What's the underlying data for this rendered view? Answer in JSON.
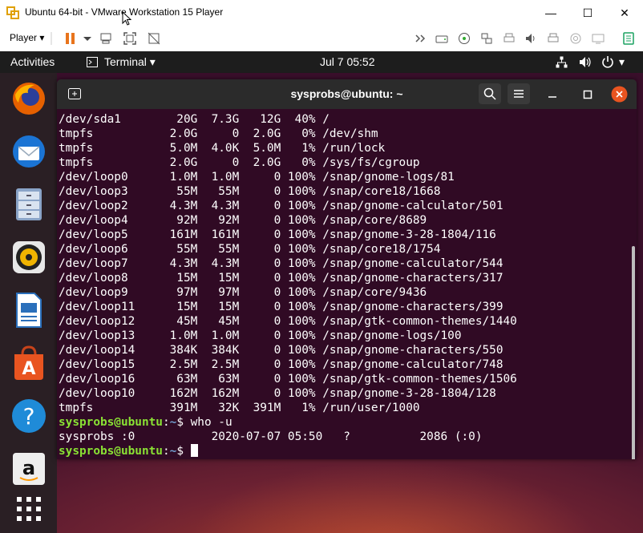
{
  "window": {
    "title": "Ubuntu 64-bit - VMware Workstation 15 Player",
    "minimize": "—",
    "maximize": "☐",
    "close": "✕"
  },
  "toolbar": {
    "player_label": "Player",
    "dropdown_arrow": "▾"
  },
  "gnome": {
    "activities": "Activities",
    "app_menu": "Terminal ▾",
    "clock": "Jul 7  05:52",
    "power_arrow": "▾"
  },
  "dock": {
    "apps": [
      "firefox-icon",
      "thunderbird-icon",
      "files-icon",
      "rhythmbox-icon",
      "writer-icon",
      "software-icon",
      "help-icon",
      "amazon-icon",
      "show-apps-icon"
    ]
  },
  "terminal": {
    "title": "sysprobs@ubuntu: ~",
    "df_rows": [
      {
        "fs": "/dev/sda1",
        "size": "20G",
        "used": "7.3G",
        "avail": "12G",
        "use": "40%",
        "mount": "/"
      },
      {
        "fs": "tmpfs",
        "size": "2.0G",
        "used": "0",
        "avail": "2.0G",
        "use": "0%",
        "mount": "/dev/shm"
      },
      {
        "fs": "tmpfs",
        "size": "5.0M",
        "used": "4.0K",
        "avail": "5.0M",
        "use": "1%",
        "mount": "/run/lock"
      },
      {
        "fs": "tmpfs",
        "size": "2.0G",
        "used": "0",
        "avail": "2.0G",
        "use": "0%",
        "mount": "/sys/fs/cgroup"
      },
      {
        "fs": "/dev/loop0",
        "size": "1.0M",
        "used": "1.0M",
        "avail": "0",
        "use": "100%",
        "mount": "/snap/gnome-logs/81"
      },
      {
        "fs": "/dev/loop3",
        "size": "55M",
        "used": "55M",
        "avail": "0",
        "use": "100%",
        "mount": "/snap/core18/1668"
      },
      {
        "fs": "/dev/loop2",
        "size": "4.3M",
        "used": "4.3M",
        "avail": "0",
        "use": "100%",
        "mount": "/snap/gnome-calculator/501"
      },
      {
        "fs": "/dev/loop4",
        "size": "92M",
        "used": "92M",
        "avail": "0",
        "use": "100%",
        "mount": "/snap/core/8689"
      },
      {
        "fs": "/dev/loop5",
        "size": "161M",
        "used": "161M",
        "avail": "0",
        "use": "100%",
        "mount": "/snap/gnome-3-28-1804/116"
      },
      {
        "fs": "/dev/loop6",
        "size": "55M",
        "used": "55M",
        "avail": "0",
        "use": "100%",
        "mount": "/snap/core18/1754"
      },
      {
        "fs": "/dev/loop7",
        "size": "4.3M",
        "used": "4.3M",
        "avail": "0",
        "use": "100%",
        "mount": "/snap/gnome-calculator/544"
      },
      {
        "fs": "/dev/loop8",
        "size": "15M",
        "used": "15M",
        "avail": "0",
        "use": "100%",
        "mount": "/snap/gnome-characters/317"
      },
      {
        "fs": "/dev/loop9",
        "size": "97M",
        "used": "97M",
        "avail": "0",
        "use": "100%",
        "mount": "/snap/core/9436"
      },
      {
        "fs": "/dev/loop11",
        "size": "15M",
        "used": "15M",
        "avail": "0",
        "use": "100%",
        "mount": "/snap/gnome-characters/399"
      },
      {
        "fs": "/dev/loop12",
        "size": "45M",
        "used": "45M",
        "avail": "0",
        "use": "100%",
        "mount": "/snap/gtk-common-themes/1440"
      },
      {
        "fs": "/dev/loop13",
        "size": "1.0M",
        "used": "1.0M",
        "avail": "0",
        "use": "100%",
        "mount": "/snap/gnome-logs/100"
      },
      {
        "fs": "/dev/loop14",
        "size": "384K",
        "used": "384K",
        "avail": "0",
        "use": "100%",
        "mount": "/snap/gnome-characters/550"
      },
      {
        "fs": "/dev/loop15",
        "size": "2.5M",
        "used": "2.5M",
        "avail": "0",
        "use": "100%",
        "mount": "/snap/gnome-calculator/748"
      },
      {
        "fs": "/dev/loop16",
        "size": "63M",
        "used": "63M",
        "avail": "0",
        "use": "100%",
        "mount": "/snap/gtk-common-themes/1506"
      },
      {
        "fs": "/dev/loop10",
        "size": "162M",
        "used": "162M",
        "avail": "0",
        "use": "100%",
        "mount": "/snap/gnome-3-28-1804/128"
      },
      {
        "fs": "tmpfs",
        "size": "391M",
        "used": "32K",
        "avail": "391M",
        "use": "1%",
        "mount": "/run/user/1000"
      }
    ],
    "prompt_user": "sysprobs@ubuntu",
    "prompt_sep": ":",
    "prompt_path": "~",
    "prompt_sign": "$ ",
    "command": "who -u",
    "who_output": "sysprobs :0           2020-07-07 05:50   ?          2086 (:0)"
  }
}
